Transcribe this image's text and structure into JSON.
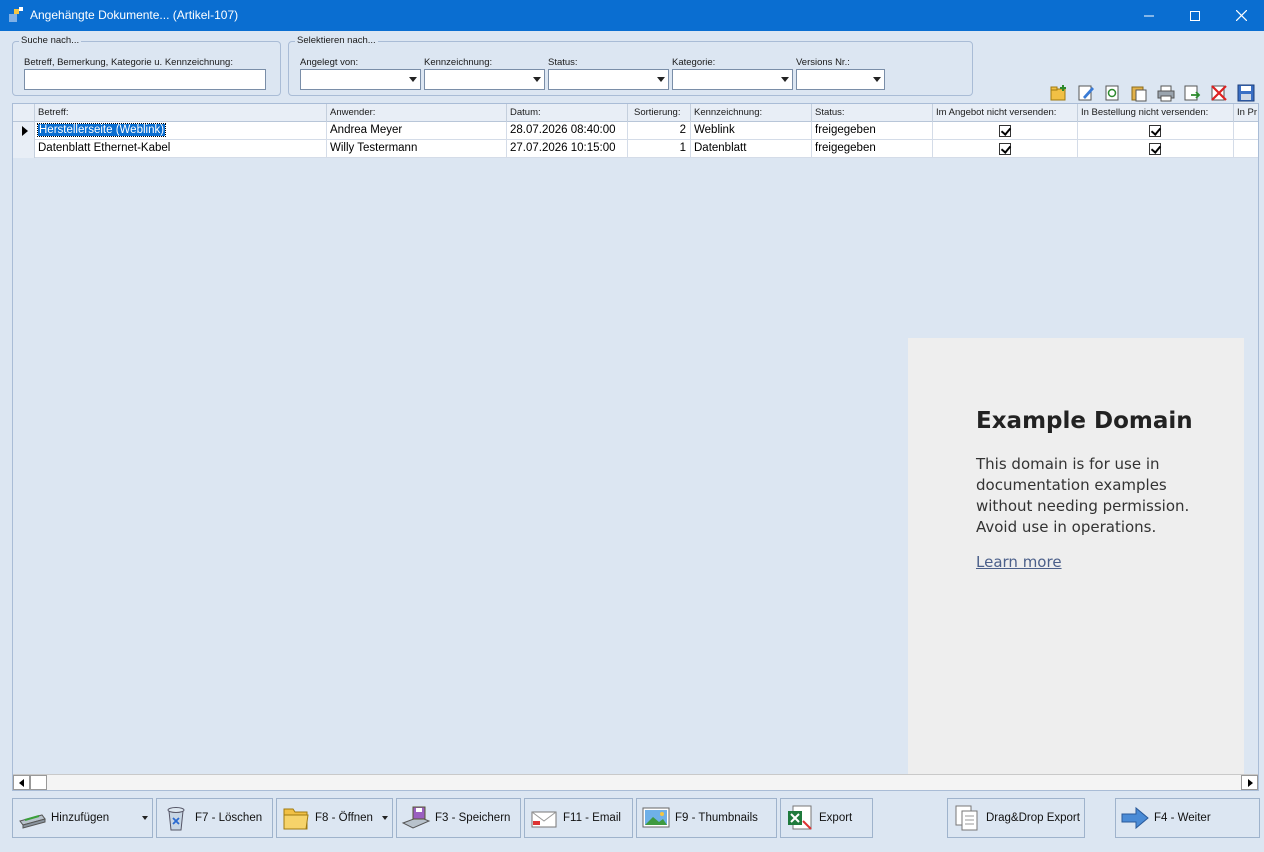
{
  "window": {
    "title": "Angehängte Dokumente... (Artikel-107)"
  },
  "search": {
    "group_title": "Suche nach...",
    "field_label": "Betreff, Bemerkung, Kategorie u. Kennzeichnung:",
    "value": ""
  },
  "filter": {
    "group_title": "Selektieren nach...",
    "angelegt_label": "Angelegt von:",
    "kennzeichnung_label": "Kennzeichnung:",
    "status_label": "Status:",
    "kategorie_label": "Kategorie:",
    "version_label": "Versions Nr.:"
  },
  "grid": {
    "columns": [
      "Betreff:",
      "Anwender:",
      "Datum:",
      "Sortierung:",
      "Kennzeichnung:",
      "Status:",
      "Im Angebot nicht versenden:",
      "In Bestellung nicht versenden:",
      "In Pr"
    ],
    "rows": [
      {
        "betreff": "Herstellerseite (Weblink)",
        "anwender": "Andrea Meyer",
        "datum": "28.07.2026 08:40:00",
        "sortierung": "2",
        "kennzeichnung": "Weblink",
        "status": "freigegeben",
        "angebot": true,
        "bestellung": true
      },
      {
        "betreff": "Datenblatt Ethernet-Kabel",
        "anwender": "Willy Testermann",
        "datum": "27.07.2026 10:15:00",
        "sortierung": "1",
        "kennzeichnung": "Datenblatt",
        "status": "freigegeben",
        "angebot": true,
        "bestellung": true
      }
    ]
  },
  "preview": {
    "heading": "Example Domain",
    "body": "This domain is for use in documentation examples without needing permission. Avoid use in operations.",
    "link": "Learn more"
  },
  "buttons": {
    "add": "Hinzufügen",
    "delete": "F7 - Löschen",
    "open": "F8 - Öffnen",
    "save": "F3 - Speichern",
    "email": "F11 - Email",
    "thumbnails": "F9 - Thumbnails",
    "export": "Export",
    "dragdrop": "Drag&Drop Export",
    "next": "F4 - Weiter"
  },
  "colors": {
    "titlebar": "#0a6ed1",
    "background": "#dce6f2",
    "selection": "#0a6ed1"
  }
}
